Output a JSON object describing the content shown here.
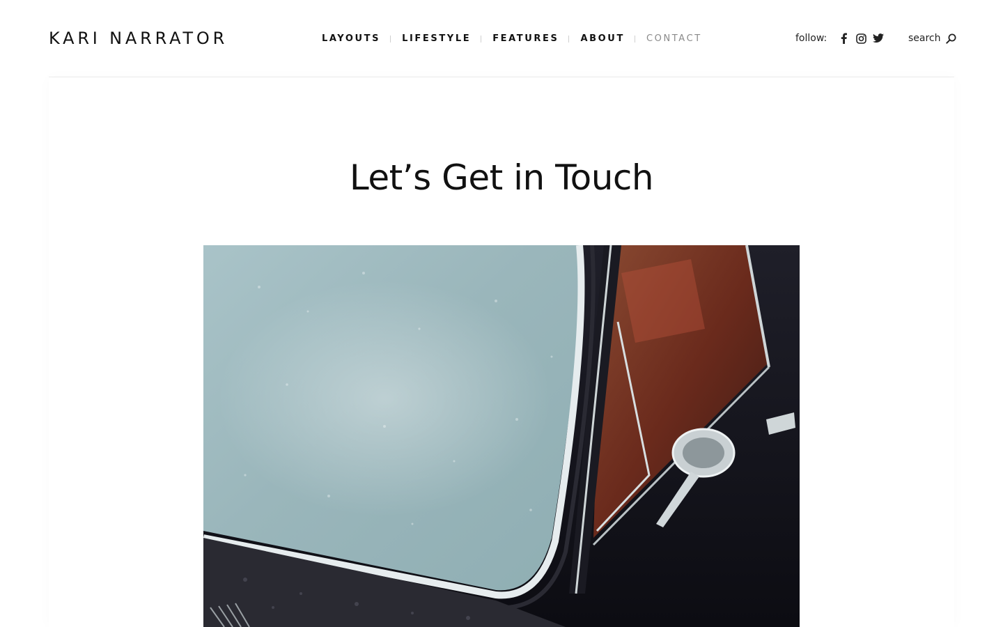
{
  "site": {
    "logo": "KARI NARRATOR"
  },
  "nav": {
    "items": [
      {
        "label": "LAYOUTS",
        "active": false
      },
      {
        "label": "LIFESTYLE",
        "active": false
      },
      {
        "label": "FEATURES",
        "active": false
      },
      {
        "label": "ABOUT",
        "active": false
      },
      {
        "label": "CONTACT",
        "active": true
      }
    ]
  },
  "header": {
    "follow_label": "follow:",
    "social": [
      {
        "icon": "facebook-icon"
      },
      {
        "icon": "instagram-icon"
      },
      {
        "icon": "twitter-icon"
      }
    ],
    "search_label": "search",
    "search_icon": "search-icon"
  },
  "main": {
    "title": "Let’s Get in Touch",
    "hero_image": {
      "subject": "vintage black car windshield with raindrops"
    }
  },
  "colors": {
    "text": "#111111",
    "active_nav": "#8a8a8a",
    "divider": "#ececec",
    "background": "#ffffff"
  }
}
